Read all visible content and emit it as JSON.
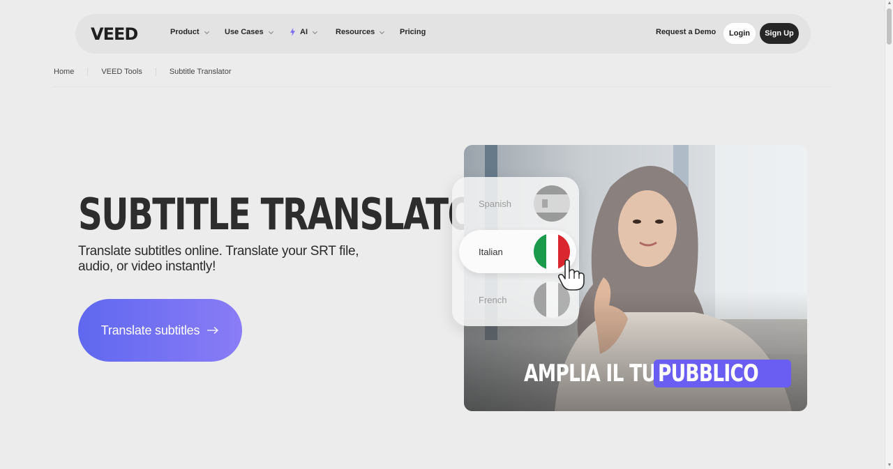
{
  "nav": {
    "logo": "VEED",
    "items": [
      {
        "label": "Product",
        "has_menu": true
      },
      {
        "label": "Use Cases",
        "has_menu": true
      },
      {
        "label": "AI",
        "has_menu": true
      },
      {
        "label": "Resources",
        "has_menu": true
      },
      {
        "label": "Pricing",
        "has_menu": false
      }
    ],
    "request_demo": "Request a Demo",
    "login": "Login",
    "signup": "Sign Up"
  },
  "breadcrumb": [
    "Home",
    "VEED Tools",
    "Subtitle Translator"
  ],
  "hero": {
    "title": "SUBTITLE TRANSLATOR",
    "subtitle": "Translate subtitles online. Translate your SRT file, audio, or video instantly!",
    "cta": "Translate subtitles"
  },
  "media": {
    "languages": [
      {
        "label": "Spanish",
        "selected": false
      },
      {
        "label": "Italian",
        "selected": true
      },
      {
        "label": "French",
        "selected": false
      }
    ],
    "caption_plain": "AMPLIA IL TUO",
    "caption_highlight": "PUBBLICO"
  },
  "colors": {
    "accent": "#6a5df2",
    "cta_gradient_start": "#5f68ef",
    "cta_gradient_end": "#8a7cf6",
    "dark_button": "#262626",
    "background": "#ececec"
  }
}
